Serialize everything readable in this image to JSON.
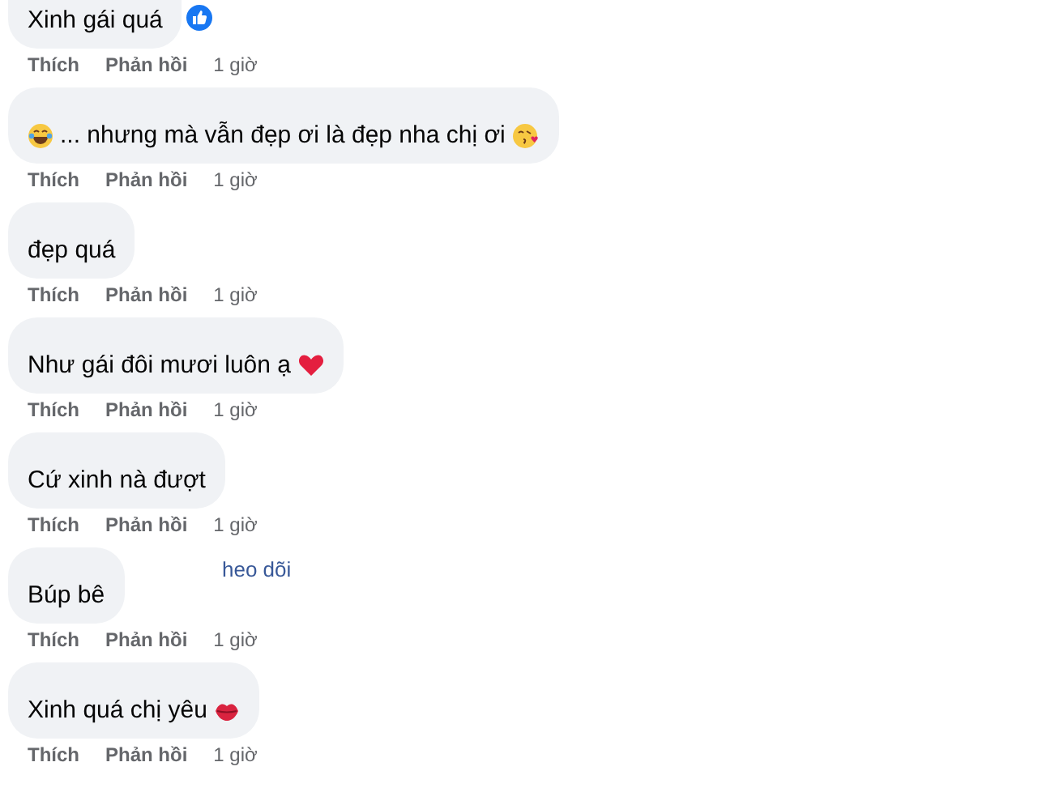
{
  "comments": [
    {
      "text": "Xinh gái quá",
      "reaction_badge": true,
      "actions": {
        "like": "Thích",
        "reply": "Phản hồi",
        "time": "1 giờ"
      }
    },
    {
      "text": "... nhưng mà vẫn đẹp ơi là đẹp nha chị ơi",
      "leading_icon": {
        "kind": "laugh"
      },
      "trailing_icon": {
        "kind": "kiss"
      },
      "actions": {
        "like": "Thích",
        "reply": "Phản hồi",
        "time": "1 giờ"
      }
    },
    {
      "text": "đẹp quá",
      "actions": {
        "like": "Thích",
        "reply": "Phản hồi",
        "time": "1 giờ"
      }
    },
    {
      "text": "Như gái đôi mươi luôn ạ",
      "trailing_icon": {
        "kind": "heart"
      },
      "actions": {
        "like": "Thích",
        "reply": "Phản hồi",
        "time": "1 giờ"
      }
    },
    {
      "text": "Cứ xinh nà đượt",
      "actions": {
        "like": "Thích",
        "reply": "Phản hồi",
        "time": "1 giờ"
      }
    },
    {
      "text": "Búp bê",
      "follow": "heo dõi",
      "actions": {
        "like": "Thích",
        "reply": "Phản hồi",
        "time": "1 giờ"
      }
    },
    {
      "text": "Xinh quá chị yêu",
      "trailing_icon": {
        "kind": "lips"
      },
      "actions": {
        "like": "Thích",
        "reply": "Phản hồi",
        "time": "1 giờ"
      }
    }
  ]
}
